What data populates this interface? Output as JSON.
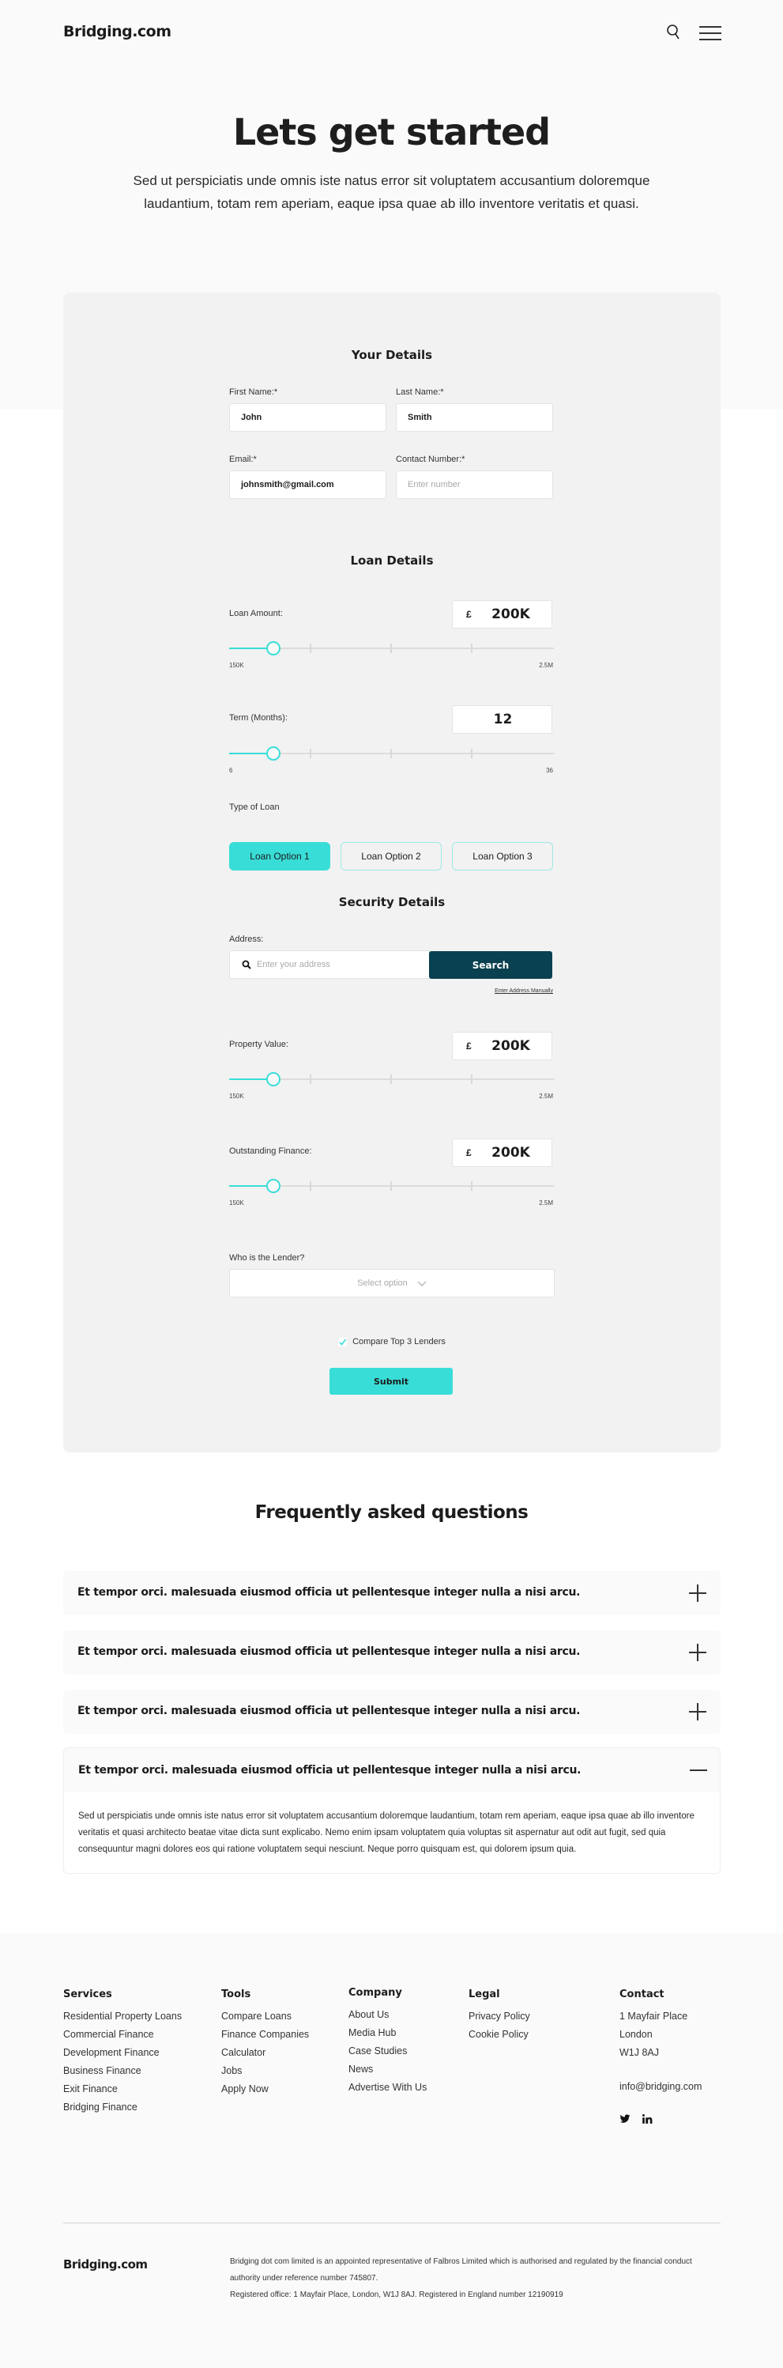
{
  "header": {
    "logo": "Bridging.com",
    "search_icon": "search-icon",
    "menu_icon": "hamburger-menu-icon"
  },
  "hero": {
    "title": "Lets get started",
    "subtitle": "Sed ut perspiciatis unde omnis iste natus error sit voluptatem accusantium doloremque laudantium, totam rem aperiam, eaque ipsa quae ab illo inventore veritatis et quasi."
  },
  "form": {
    "your_details": {
      "title": "Your Details",
      "first_name": {
        "label": "First Name:*",
        "value": "John"
      },
      "last_name": {
        "label": "Last Name:*",
        "value": "Smith"
      },
      "email": {
        "label": "Email:*",
        "value": "johnsmith@gmail.com"
      },
      "contact": {
        "label": "Contact Number:*",
        "value": "",
        "placeholder": "Enter number"
      }
    },
    "loan_details": {
      "title": "Loan Details",
      "loan_amount": {
        "label": "Loan Amount:",
        "currency": "£",
        "value": "200K",
        "min": "150K",
        "max": "2.5M",
        "fraction": 0.137
      },
      "term": {
        "label": "Term (Months):",
        "value": "12",
        "min": "6",
        "max": "36",
        "fraction": 0.137
      },
      "type_label": "Type of Loan",
      "options": [
        {
          "label": "Loan Option 1",
          "selected": true
        },
        {
          "label": "Loan Option 2",
          "selected": false
        },
        {
          "label": "Loan Option 3",
          "selected": false
        }
      ]
    },
    "security_details": {
      "title": "Security Details",
      "address": {
        "label": "Address:",
        "placeholder": "Enter your address",
        "search_label": "Search",
        "manual_link": "Enter Address Manually"
      },
      "property_value": {
        "label": "Property Value:",
        "currency": "£",
        "value": "200K",
        "min": "150K",
        "max": "2.5M",
        "fraction": 0.137
      },
      "outstanding_finance": {
        "label": "Outstanding Finance:",
        "currency": "£",
        "value": "200K",
        "min": "150K",
        "max": "2.5M",
        "fraction": 0.137
      },
      "lender": {
        "label": "Who is the Lender?",
        "placeholder": "Select option"
      }
    },
    "compare": {
      "label": "Compare Top 3 Lenders",
      "checked": true
    },
    "submit_label": "Submit"
  },
  "faq": {
    "title": "Frequently asked questions",
    "items": [
      {
        "question": "Et tempor orci. malesuada eiusmod officia ut pellentesque integer nulla a nisi arcu.",
        "expanded": false
      },
      {
        "question": "Et tempor orci. malesuada eiusmod officia ut pellentesque integer nulla a nisi arcu.",
        "expanded": false
      },
      {
        "question": "Et tempor orci. malesuada eiusmod officia ut pellentesque integer nulla a nisi arcu.",
        "expanded": false
      },
      {
        "question": "Et tempor orci. malesuada eiusmod officia ut pellentesque integer nulla a nisi arcu.",
        "expanded": true,
        "answer": "Sed ut perspiciatis unde omnis iste natus error sit voluptatem accusantium doloremque laudantium, totam rem aperiam, eaque ipsa quae ab illo inventore veritatis et quasi architecto beatae vitae dicta sunt explicabo. Nemo enim ipsam voluptatem quia voluptas sit aspernatur aut odit aut fugit, sed quia consequuntur magni dolores eos qui ratione voluptatem sequi nesciunt. Neque porro quisquam est, qui dolorem ipsum quia."
      }
    ]
  },
  "footer": {
    "services": {
      "title": "Services",
      "links": [
        "Residential Property Loans",
        "Commercial Finance",
        "Development Finance",
        "Business Finance",
        "Exit Finance",
        "Bridging Finance"
      ]
    },
    "tools": {
      "title": "Tools",
      "links": [
        "Compare Loans",
        "Finance Companies",
        "Calculator",
        "Jobs",
        "Apply Now"
      ]
    },
    "company": {
      "title": "Company",
      "links": [
        "About Us",
        "Media Hub",
        "Case Studies",
        "News",
        "Advertise With Us"
      ]
    },
    "legal": {
      "title": "Legal",
      "links": [
        "Privacy Policy",
        "Cookie Policy"
      ]
    },
    "contact": {
      "title": "Contact",
      "address": [
        "1 Mayfair Place",
        "London",
        "W1J 8AJ"
      ],
      "email": "info@bridging.com",
      "social": [
        "twitter-icon",
        "linkedin-icon"
      ]
    },
    "logo": "Bridging.com",
    "legal_text_1": "Bridging dot com limited is an appointed representative of Falbros Limited which is authorised and regulated by the financial conduct authority under reference number 745807.",
    "legal_text_2": "Registered office: 1 Mayfair Place, London, W1J 8AJ. Registered in England number 12190919"
  },
  "colors": {
    "accent": "#39ddd7",
    "search_button": "#0a4150",
    "card_bg": "#f2f2f2",
    "page_bg": "#fafafa"
  }
}
